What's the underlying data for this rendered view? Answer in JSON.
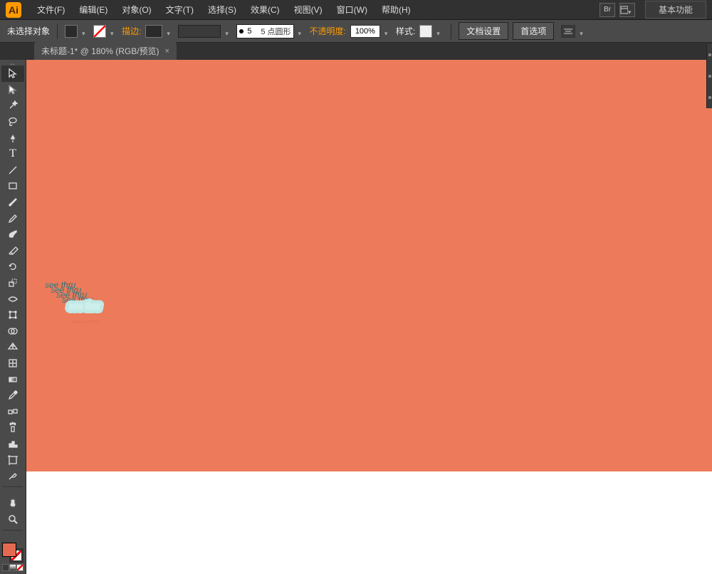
{
  "app": {
    "logo": "Ai"
  },
  "menu": {
    "items": [
      "文件(F)",
      "编辑(E)",
      "对象(O)",
      "文字(T)",
      "选择(S)",
      "效果(C)",
      "视图(V)",
      "窗口(W)",
      "帮助(H)"
    ],
    "br": "Br",
    "workspace": "基本功能"
  },
  "control": {
    "selection": "未选择对象",
    "stroke_label": "描边:",
    "stroke_width": "5",
    "brush_preset": "5 点圆形",
    "opacity_label": "不透明度:",
    "opacity_value": "100%",
    "style_label": "样式:",
    "doc_setup": "文档设置",
    "prefs": "首选项"
  },
  "tab": {
    "title": "未标题-1* @ 180% (RGB/预览)",
    "close": "×"
  },
  "artwork": {
    "text": "see thru",
    "bg_color": "#ed7a5a",
    "extrude_color": "#2c8a93",
    "face_stroke": "#b8e2e0",
    "shadow_color": "#c85e48"
  },
  "tools": [
    {
      "name": "selection",
      "glyph": "cursor"
    },
    {
      "name": "direct-select",
      "glyph": "cursor-white"
    },
    {
      "name": "magic-wand",
      "glyph": "wand"
    },
    {
      "name": "lasso",
      "glyph": "lasso"
    },
    {
      "name": "pen",
      "glyph": "pen"
    },
    {
      "name": "type",
      "glyph": "T"
    },
    {
      "name": "line",
      "glyph": "line"
    },
    {
      "name": "rectangle",
      "glyph": "rect"
    },
    {
      "name": "paintbrush",
      "glyph": "brush"
    },
    {
      "name": "pencil",
      "glyph": "pencil"
    },
    {
      "name": "blob-brush",
      "glyph": "blob"
    },
    {
      "name": "eraser",
      "glyph": "eraser"
    },
    {
      "name": "rotate",
      "glyph": "rotate"
    },
    {
      "name": "scale",
      "glyph": "scale"
    },
    {
      "name": "width",
      "glyph": "width"
    },
    {
      "name": "free-transform",
      "glyph": "xform"
    },
    {
      "name": "shape-builder",
      "glyph": "sb"
    },
    {
      "name": "perspective",
      "glyph": "persp"
    },
    {
      "name": "mesh",
      "glyph": "mesh"
    },
    {
      "name": "gradient",
      "glyph": "grad"
    },
    {
      "name": "eyedropper",
      "glyph": "eye"
    },
    {
      "name": "blend",
      "glyph": "blend"
    },
    {
      "name": "symbol-sprayer",
      "glyph": "spray"
    },
    {
      "name": "column-graph",
      "glyph": "graph"
    },
    {
      "name": "artboard",
      "glyph": "ab"
    },
    {
      "name": "slice",
      "glyph": "slice"
    },
    {
      "name": "hand",
      "glyph": "hand"
    },
    {
      "name": "zoom",
      "glyph": "zoom"
    }
  ]
}
